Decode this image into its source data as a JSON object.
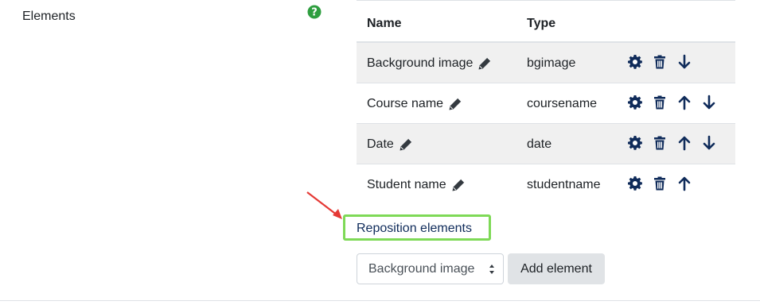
{
  "section": {
    "label": "Elements",
    "help_icon": "question-circle-icon"
  },
  "table": {
    "headers": {
      "name": "Name",
      "type": "Type"
    },
    "rows": [
      {
        "name": "Background image",
        "type": "bgimage",
        "actions": [
          "settings",
          "delete",
          "move-down"
        ]
      },
      {
        "name": "Course name",
        "type": "coursename",
        "actions": [
          "settings",
          "delete",
          "move-up",
          "move-down"
        ]
      },
      {
        "name": "Date",
        "type": "date",
        "actions": [
          "settings",
          "delete",
          "move-up",
          "move-down"
        ]
      },
      {
        "name": "Student name",
        "type": "studentname",
        "actions": [
          "settings",
          "delete",
          "move-up"
        ]
      }
    ]
  },
  "reposition": {
    "label": "Reposition elements",
    "highlight_color": "#7ed957",
    "arrow_color": "#e53935"
  },
  "add_element": {
    "select_value": "Background image",
    "button_label": "Add element"
  },
  "colors": {
    "icon": "#0f2b5a",
    "help": "#2e9e3f",
    "stripe": "#f0f0f0"
  }
}
